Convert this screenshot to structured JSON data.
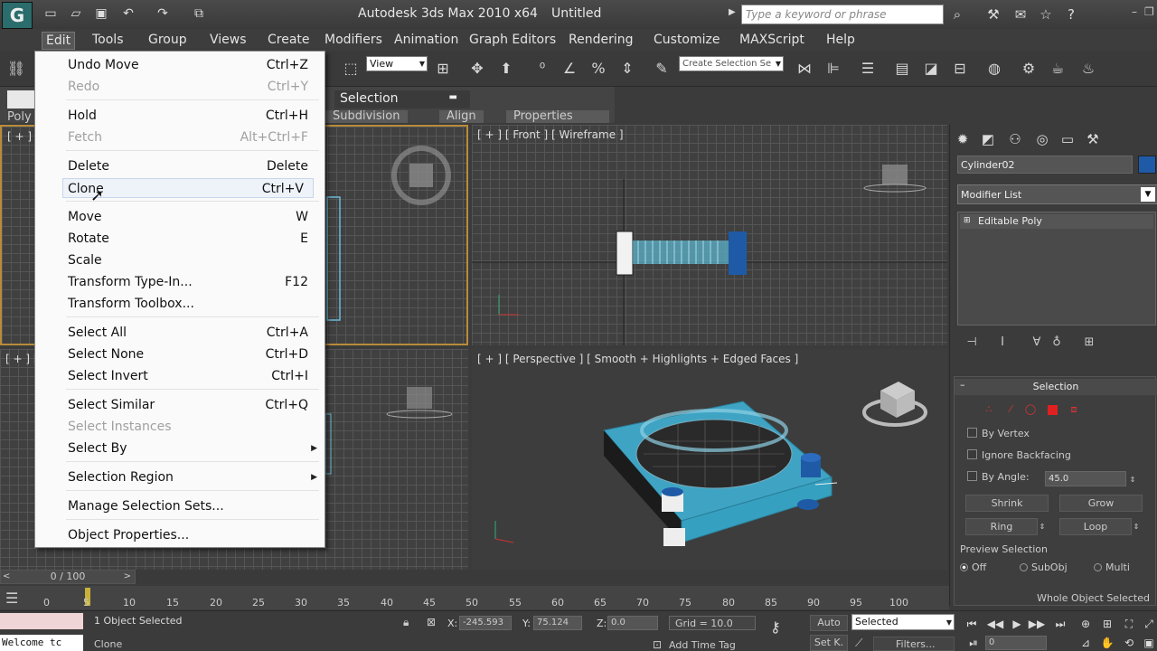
{
  "titlebar": {
    "app_logo": "G",
    "title": "Autodesk 3ds Max  2010 x64",
    "document": "Untitled",
    "search_placeholder": "Type a keyword or phrase",
    "quick_access": [
      "new-file-icon",
      "open-file-icon",
      "save-icon",
      "undo-icon",
      "redo-icon",
      "project-folder-icon"
    ],
    "info_icons": [
      "binoculars-icon",
      "key-tools-icon",
      "subscription-icon",
      "favorites-star-icon",
      "help-icon"
    ]
  },
  "menubar": {
    "items": [
      "Edit",
      "Tools",
      "Group",
      "Views",
      "Create",
      "Modifiers",
      "Animation",
      "Graph Editors",
      "Rendering",
      "Customize",
      "MAXScript",
      "Help"
    ]
  },
  "toolbar": {
    "view_select": "View",
    "selection_set_placeholder": "Create Selection Se"
  },
  "ribbon": {
    "panel_title": "Selection",
    "tabs": [
      "Subdivision",
      "Align",
      "Properties"
    ],
    "poly_label": "Poly"
  },
  "edit_menu": {
    "items": [
      {
        "label": "Undo Move",
        "shortcut": "Ctrl+Z",
        "enabled": true
      },
      {
        "label": "Redo",
        "shortcut": "Ctrl+Y",
        "enabled": false
      },
      {
        "label": "Hold",
        "shortcut": "Ctrl+H",
        "enabled": true
      },
      {
        "label": "Fetch",
        "shortcut": "Alt+Ctrl+F",
        "enabled": false
      },
      {
        "label": "Delete",
        "shortcut": "Delete",
        "enabled": true
      },
      {
        "label": "Clone",
        "shortcut": "Ctrl+V",
        "enabled": true,
        "hover": true
      },
      {
        "label": "Move",
        "shortcut": "W",
        "enabled": true
      },
      {
        "label": "Rotate",
        "shortcut": "E",
        "enabled": true
      },
      {
        "label": "Scale",
        "shortcut": "",
        "enabled": true
      },
      {
        "label": "Transform Type-In...",
        "shortcut": "F12",
        "enabled": true
      },
      {
        "label": "Transform Toolbox...",
        "shortcut": "",
        "enabled": true
      },
      {
        "label": "Select All",
        "shortcut": "Ctrl+A",
        "enabled": true
      },
      {
        "label": "Select None",
        "shortcut": "Ctrl+D",
        "enabled": true
      },
      {
        "label": "Select Invert",
        "shortcut": "Ctrl+I",
        "enabled": true
      },
      {
        "label": "Select Similar",
        "shortcut": "Ctrl+Q",
        "enabled": true
      },
      {
        "label": "Select Instances",
        "shortcut": "",
        "enabled": false
      },
      {
        "label": "Select By",
        "shortcut": "",
        "enabled": true,
        "submenu": true
      },
      {
        "label": "Selection Region",
        "shortcut": "",
        "enabled": true,
        "submenu": true
      },
      {
        "label": "Manage Selection Sets...",
        "shortcut": "",
        "enabled": true
      },
      {
        "label": "Object Properties...",
        "shortcut": "",
        "enabled": true
      }
    ]
  },
  "viewports": {
    "top_label": "[ + ] [ T",
    "front_label": "[ + ] [ Front ] [ Wireframe ]",
    "left_label": "[ + ] [ L",
    "perspective_label": "[ + ] [ Perspective ] [ Smooth + Highlights + Edged Faces ]"
  },
  "command_panel": {
    "object_name": "Cylinder02",
    "object_color": "#1f5aa6",
    "modifier_list": "Modifier List",
    "stack_item": "Editable Poly",
    "rollout_title": "Selection",
    "by_vertex": "By Vertex",
    "ignore_backfacing": "Ignore Backfacing",
    "by_angle": "By Angle:",
    "angle_value": "45.0",
    "shrink": "Shrink",
    "grow": "Grow",
    "ring": "Ring",
    "loop": "Loop",
    "preview_selection": "Preview Selection",
    "preview_options": [
      "Off",
      "SubObj",
      "Multi"
    ],
    "whole_object": "Whole Object Selected"
  },
  "timeline": {
    "slider_text": "0 / 100",
    "ticks": [
      "0",
      "5",
      "10",
      "15",
      "20",
      "25",
      "30",
      "35",
      "40",
      "45",
      "50",
      "55",
      "60",
      "65",
      "70",
      "75",
      "80",
      "85",
      "90",
      "95",
      "100"
    ]
  },
  "status": {
    "maxscript_listener": "Welcome tc",
    "selection_count": "1 Object Selected",
    "prompt": "Clone",
    "x_label": "X:",
    "x_value": "-245.593",
    "y_label": "Y:",
    "y_value": "75.124",
    "z_label": "Z:",
    "z_value": "0.0",
    "grid": "Grid = 10.0",
    "add_time_tag": "Add Time Tag",
    "auto_key": "Auto",
    "set_key": "Set K.",
    "key_mode": "Selected",
    "filters": "Filters...",
    "frame": "0"
  },
  "colors": {
    "accent_viewport_border": "#b98b3a",
    "object_color": "#1f5aa6",
    "mesh_cyan": "#3fa4c4"
  }
}
